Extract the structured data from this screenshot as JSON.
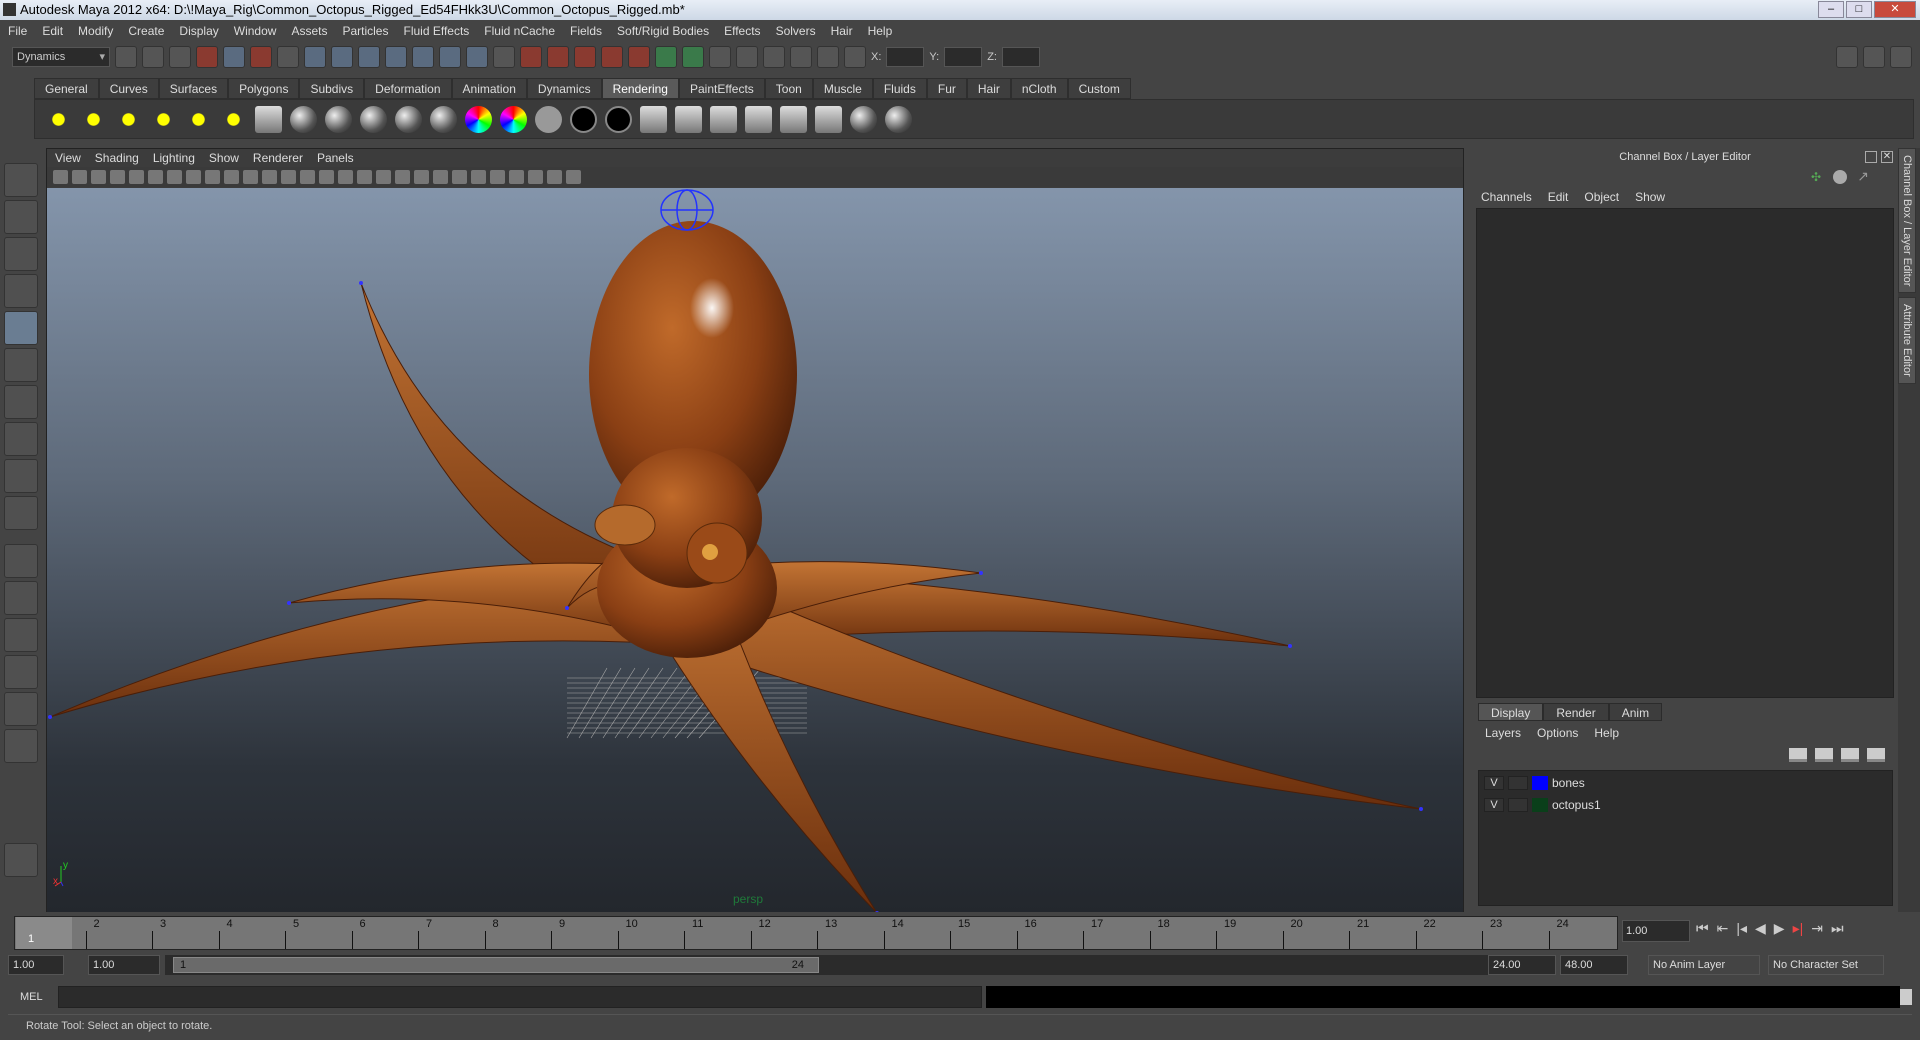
{
  "title": "Autodesk Maya 2012 x64: D:\\!Maya_Rig\\Common_Octopus_Rigged_Ed54FHkk3U\\Common_Octopus_Rigged.mb*",
  "menu": [
    "File",
    "Edit",
    "Modify",
    "Create",
    "Display",
    "Window",
    "Assets",
    "Particles",
    "Fluid Effects",
    "Fluid nCache",
    "Fields",
    "Soft/Rigid Bodies",
    "Effects",
    "Solvers",
    "Hair",
    "Help"
  ],
  "toolbar": {
    "mode": "Dynamics",
    "x_label": "X:",
    "y_label": "Y:",
    "z_label": "Z:"
  },
  "shelf_tabs": [
    "General",
    "Curves",
    "Surfaces",
    "Polygons",
    "Subdivs",
    "Deformation",
    "Animation",
    "Dynamics",
    "Rendering",
    "PaintEffects",
    "Toon",
    "Muscle",
    "Fluids",
    "Fur",
    "Hair",
    "nCloth",
    "Custom"
  ],
  "active_shelf": "Rendering",
  "viewport": {
    "menu": [
      "View",
      "Shading",
      "Lighting",
      "Show",
      "Renderer",
      "Panels"
    ],
    "camera": "persp",
    "axis_x": "x",
    "axis_y": "y"
  },
  "channel_box": {
    "title": "Channel Box / Layer Editor",
    "menu": [
      "Channels",
      "Edit",
      "Object",
      "Show"
    ]
  },
  "layer_editor": {
    "tabs": [
      "Display",
      "Render",
      "Anim"
    ],
    "active_tab": "Display",
    "menu": [
      "Layers",
      "Options",
      "Help"
    ],
    "layers": [
      {
        "visible": "V",
        "name": "bones",
        "color": "#0000ff"
      },
      {
        "visible": "V",
        "name": "octopus1",
        "color": "#0a3f1a"
      }
    ]
  },
  "side_tabs": [
    "Channel Box / Layer Editor",
    "Attribute Editor"
  ],
  "timeline": {
    "frames": [
      "1",
      "2",
      "3",
      "4",
      "5",
      "6",
      "7",
      "8",
      "9",
      "10",
      "11",
      "12",
      "13",
      "14",
      "15",
      "16",
      "17",
      "18",
      "19",
      "20",
      "21",
      "22",
      "23",
      "24"
    ],
    "current_marker": "1",
    "current_frame": "1.00"
  },
  "range": {
    "start": "1.00",
    "playback_start": "1.00",
    "bar_start": "1",
    "bar_end": "24",
    "playback_end": "24.00",
    "end": "48.00",
    "anim_layer": "No Anim Layer",
    "char_set": "No Character Set"
  },
  "mel": {
    "label": "MEL"
  },
  "help_line": "Rotate Tool: Select an object to rotate."
}
